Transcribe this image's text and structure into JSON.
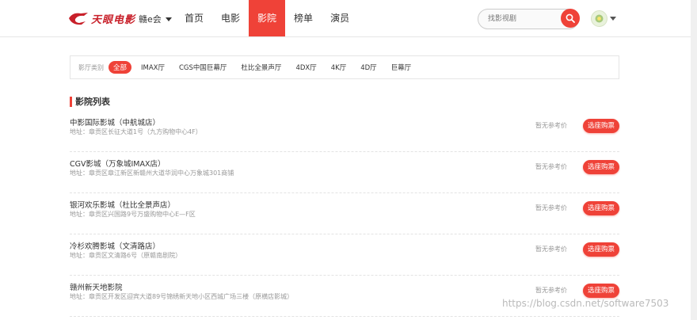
{
  "header": {
    "logo_text": "天眼电影",
    "city": "赣e会",
    "nav": [
      {
        "label": "首页",
        "active": false
      },
      {
        "label": "电影",
        "active": false
      },
      {
        "label": "影院",
        "active": true
      },
      {
        "label": "榜单",
        "active": false
      },
      {
        "label": "演员",
        "active": false
      }
    ],
    "search_placeholder": "找影视剧",
    "accent_color": "#ef4238"
  },
  "filter": {
    "label": "影厅类别",
    "tags": [
      {
        "label": "全部",
        "active": true
      },
      {
        "label": "IMAX厅",
        "active": false
      },
      {
        "label": "CGS中国巨幕厅",
        "active": false
      },
      {
        "label": "杜比全景声厅",
        "active": false
      },
      {
        "label": "4DX厅",
        "active": false
      },
      {
        "label": "4K厅",
        "active": false
      },
      {
        "label": "4D厅",
        "active": false
      },
      {
        "label": "巨幕厅",
        "active": false
      }
    ]
  },
  "section_title": "影院列表",
  "cinemas": [
    {
      "name": "中影国际影城（中航城店）",
      "address": "地址：章贡区长征大道1号（九方购物中心4F）",
      "price": "暂无参考价",
      "button": "选座购票"
    },
    {
      "name": "CGV影城（万象城IMAX店）",
      "address": "地址：章贡区章江新区新赣州大道华润中心万象城301商铺",
      "price": "暂无参考价",
      "button": "选座购票"
    },
    {
      "name": "银河欢乐影城（杜比全景声店）",
      "address": "地址：章贡区兴国路9号万盛购物中心E—F区",
      "price": "暂无参考价",
      "button": "选座购票"
    },
    {
      "name": "冷杉欢腾影城（文清路店）",
      "address": "地址：章贡区文清路6号（原赣南剧院）",
      "price": "暂无参考价",
      "button": "选座购票"
    },
    {
      "name": "赣州新天地影院",
      "address": "地址：章贡区开发区迎宾大道89号锦绣新天地小区西城广场三楼（原横店影城）",
      "price": "暂无参考价",
      "button": "选座购票"
    }
  ],
  "watermark": "https://blog.csdn.net/software7503"
}
